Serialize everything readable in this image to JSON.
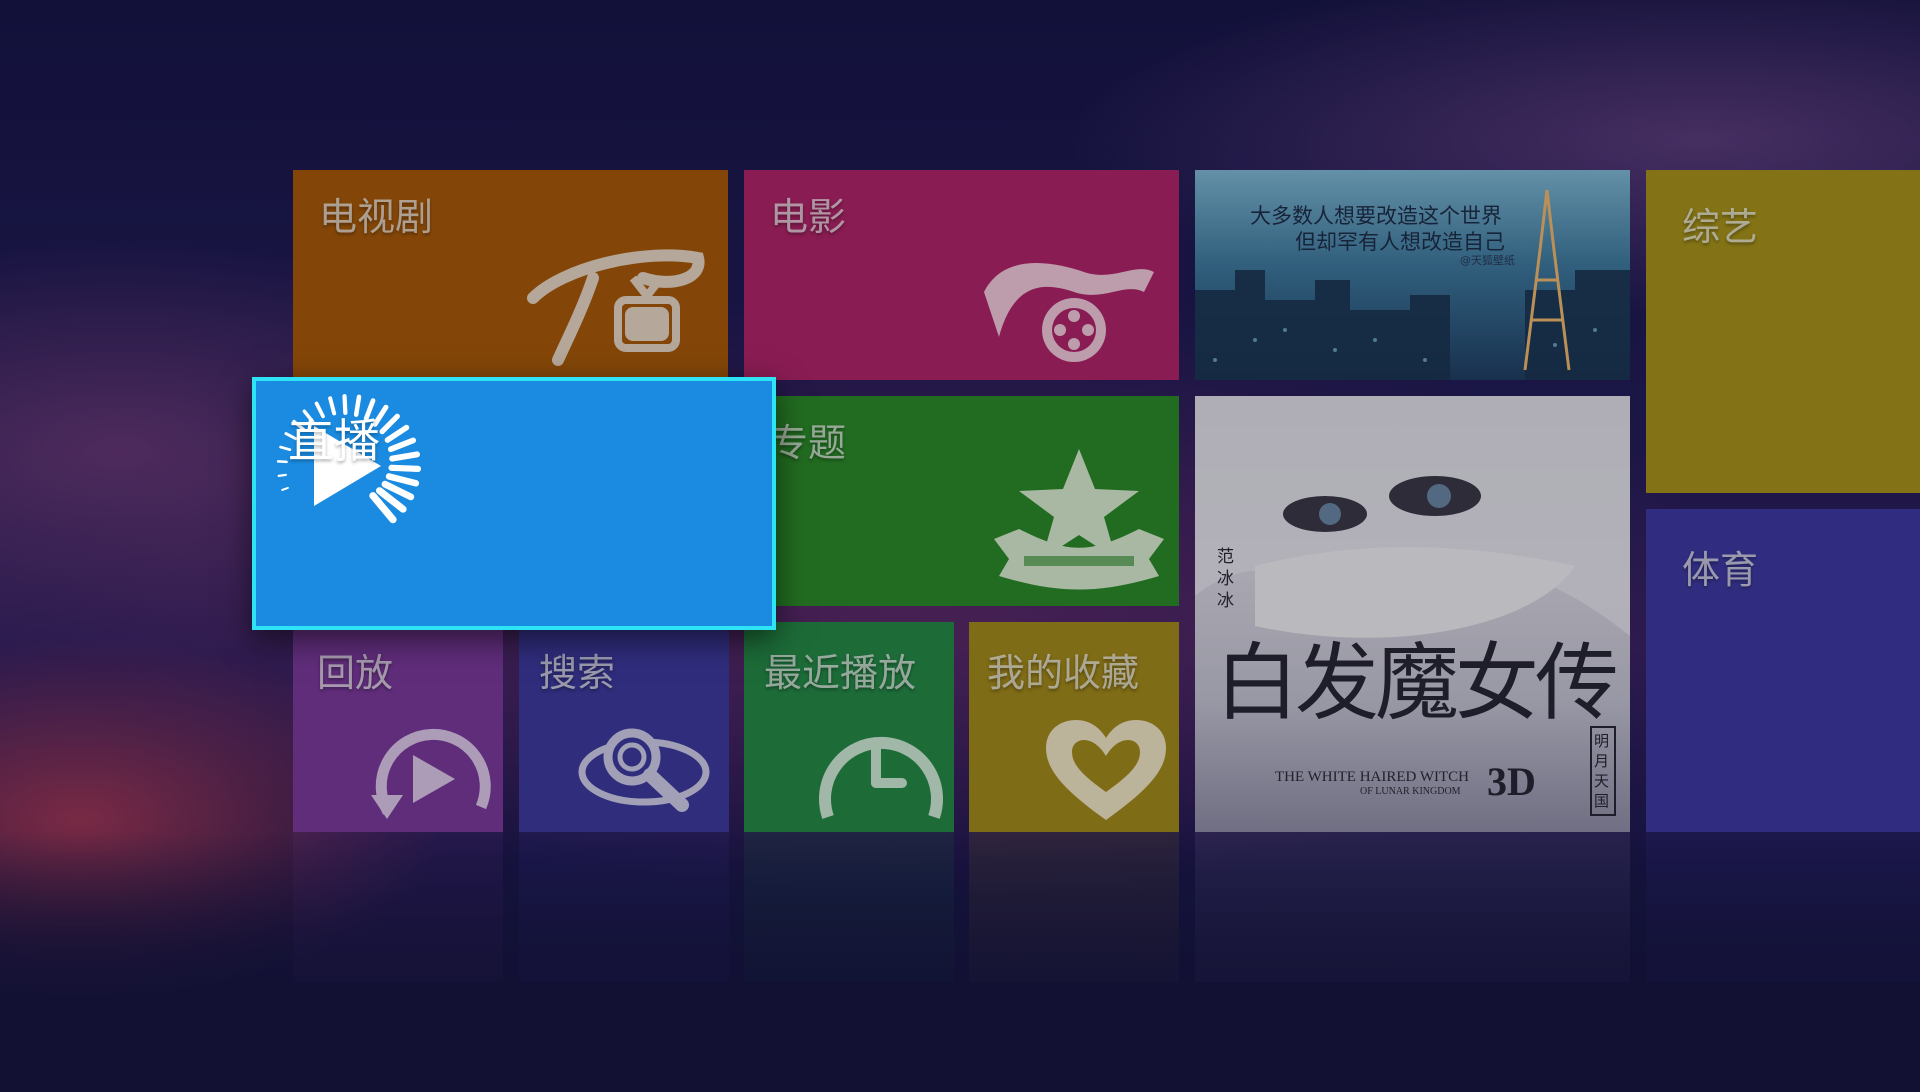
{
  "tiles": {
    "tv_series": {
      "label": "电视剧",
      "color": "#a85a0a"
    },
    "movies": {
      "label": "电影",
      "color": "#b0246a"
    },
    "live": {
      "label": "直播",
      "color": "#1a8be0"
    },
    "topics": {
      "label": "专题",
      "color": "#2b8a2a"
    },
    "replay": {
      "label": "回放",
      "color": "#7b3a9e"
    },
    "search": {
      "label": "搜索",
      "color": "#3d3aa0"
    },
    "recent": {
      "label": "最近播放",
      "color": "#258a48"
    },
    "favorites": {
      "label": "我的收藏",
      "color": "#a38a1c"
    },
    "variety": {
      "label": "综艺",
      "color": "#a8941c"
    },
    "sports": {
      "label": "体育",
      "color": "#3e3aa4"
    }
  },
  "posters": {
    "city": {
      "line1": "大多数人想要改造这个世界",
      "line2": "但却罕有人想改造自己",
      "credit": "@天狐壁纸"
    },
    "witch": {
      "title_cn": "白发魔女传",
      "title_en": "THE WHITE HAIRED WITCH",
      "subtitle_en": "OF LUNAR KINGDOM",
      "badge": "3D",
      "actor": "范冰冰",
      "side_text": "明月天国"
    }
  },
  "icons": {
    "tv_series": "tv-icon",
    "movies": "film-reel-icon",
    "live": "play-icon",
    "topics": "star-ribbon-icon",
    "replay": "replay-icon",
    "search": "search-icon",
    "recent": "clock-icon",
    "favorites": "heart-icon"
  }
}
